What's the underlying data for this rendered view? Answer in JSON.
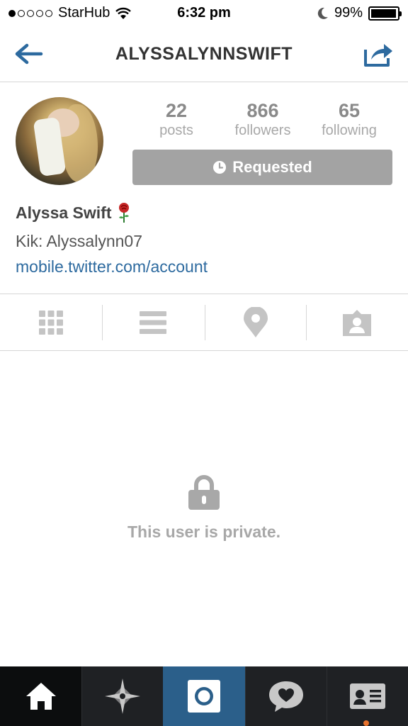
{
  "status_bar": {
    "carrier": "StarHub",
    "time": "6:32 pm",
    "battery": "99%",
    "signal_bars_filled": 1,
    "signal_bars_total": 5,
    "battery_level": 0.99
  },
  "nav": {
    "title": "ALYSSALYNNSWIFT",
    "back_icon": "back-arrow-icon",
    "share_icon": "share-icon",
    "accent": "#2d6a9f"
  },
  "profile": {
    "stats": [
      {
        "value": "22",
        "label": "posts"
      },
      {
        "value": "866",
        "label": "followers"
      },
      {
        "value": "65",
        "label": "following"
      }
    ],
    "follow_button": "Requested",
    "name": "Alyssa Swift",
    "bio": "Kik: Alyssalynn07",
    "link": "mobile.twitter.com/account"
  },
  "tabs": [
    {
      "icon": "grid-icon"
    },
    {
      "icon": "list-icon"
    },
    {
      "icon": "location-pin-icon"
    },
    {
      "icon": "tagged-photos-icon"
    }
  ],
  "private_message": "This user is private.",
  "bottom_bar": [
    {
      "icon": "home-icon"
    },
    {
      "icon": "explore-star-icon"
    },
    {
      "icon": "camera-icon"
    },
    {
      "icon": "activity-heart-icon"
    },
    {
      "icon": "profile-card-icon"
    }
  ],
  "colors": {
    "link": "#2d6a9f",
    "button_gray": "#a3a3a3",
    "bottom_bar": "#1f2124",
    "camera_tab": "#2b5f8a",
    "notification_dot": "#e8722c"
  }
}
